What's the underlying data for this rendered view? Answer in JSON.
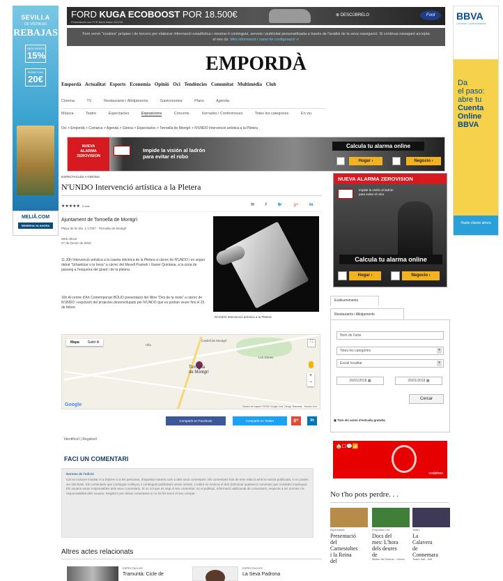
{
  "left_ad": {
    "city": "SEVILLA",
    "tagline": "DE VISITA EN",
    "headline": "REBAJAS",
    "offer1": "15%",
    "offer1_note": "DESCUENTO",
    "offer2": "20€",
    "offer2_note": "BONO CON",
    "brand": "MELIÃ.COM",
    "cta": "RESERVA YA AHORA"
  },
  "right_ad": {
    "brand": "BBVA",
    "brand_sub": "Creando Oportunidades",
    "lines": [
      "Da",
      "el paso:",
      "abre tu"
    ],
    "highlight": [
      "Cuenta",
      "Online",
      "BBVA"
    ],
    "cta": "Hazte cliente ahora"
  },
  "top_banner": {
    "text_prefix": "FORD ",
    "text_model": "KUGA ECOBOOST",
    "text_price": " POR 18.500€",
    "fine_print": "Financiando con FCE Bank hasta 31/1/18",
    "discover": "⊕ DESCÚBRELO",
    "logo": "Ford"
  },
  "cookie": {
    "text": "Fem servir \"cookies\" pròpies i de tercers per elaborar informació estadística i mostrar-li continguts, serveis i publicitat personalitzada a través de l'anàlisi de la seva navegació. Si continua navegant accepta el seu ús.",
    "link": "Més informació i canvi de configuració",
    "ok": "✔"
  },
  "masthead": "EMPORDÀ",
  "main_nav": [
    "Empordà",
    "Actualitat",
    "Esports",
    "Economia",
    "Opinió",
    "Oci",
    "Tendències",
    "Comunitat",
    "Multimèdia",
    "Club"
  ],
  "sub_nav1": [
    "Cinema",
    "TV",
    "Restaurants i Allotjaments",
    "Gastronomia",
    "Plans",
    "Agenda"
  ],
  "sub_nav2": [
    "Música",
    "Teatre",
    "Espectacles",
    "Exposicions",
    "Concerts",
    "Xerrades i Conferències",
    "Totes les categories",
    "En viu"
  ],
  "breadcrumb": "Oci > Empordà > Comarca > Agenda > Girona > Espectacles > Torroella de Montgrí > N'UNDO Intervenció artística a la Pletera",
  "alarm_wide": {
    "badge": [
      "NUEVA",
      "ALARMA",
      "ZEROVISION"
    ],
    "message": [
      "Impide la visión al ladrón",
      "para evitar el robo"
    ],
    "cta": "Calcula tu alarma online",
    "btn1": "Hogar ›",
    "btn2": "Negocio ›"
  },
  "article": {
    "category": "ESPECTACLES A GIRONA",
    "title": "N'UNDO Intervenció artística a la Pletera",
    "rating": "★★★★★",
    "votes": "0 vots",
    "share_mail": "✉",
    "share_fb": "f",
    "share_tw": "🐦",
    "share_gp": "g+",
    "share_li": "in",
    "venue": "Ajuntament de Torroella de Montgrí",
    "address": "Plaça de la Vila, 1 17257 - Torroella de Montgrí",
    "web": "Web oficial",
    "date": "27 de Gener de 2018",
    "p1": "11.30h Intervenció artística a la caseta elèctrica de la Pletera a càrrec de N'UNDO i en seguir debat \"Urbanitzar o la Ireva\" a càrrec del Mesell Pramelr i Xavier Quintana, a la zona de passeig a l'esquerra del girant i de la pletera.",
    "p2": "16h Al centre d'Art Contemporani BÒLID presentació del llibre \"Des de la resta\" a càrrec de N'UNDO i exposició del projectes desenvolupats per N'UNDO que es podran veure fins el 25 de febrer.",
    "caption": "N'UNDO Intervenció artística a la Pletera"
  },
  "map": {
    "tab_map": "Mapa",
    "tab_sat": "Satèl·lit",
    "town": [
      "Torroella",
      "de Montgrí"
    ],
    "castle": "Castell de Montgrí",
    "place1": "Les Dunes",
    "place2": "Ulla",
    "google": "Google",
    "attribution": "Dades de mapes ©2018 Google, Inst. Geogr. Nacional · Termes d'ús"
  },
  "share_buttons": {
    "facebook": "Compartir en Facebook",
    "twitter": "Compartir en Twitter",
    "gplus": "g+",
    "linkedin": "in"
  },
  "login": "Identifica't | Registra't",
  "comment": {
    "heading": "FACI UN COMENTARI",
    "norms_title": "Normes de l'edició",
    "norms_text": "Cal no incloure insultar ni a d'altres ni a les persones, d'aquesta manera com a dels seus comentaris. Els comentaris han de tenir relació amb la notícia publicada; si no poden ser eliminats. Els comentaris que continguin enllaços o continguts publicitaris seran retirats. L'editor es reserva el dret d'eliminar qualsevol comentari que consideri inadequat. Els usuaris seran responsables dels seus comentaris. Si no vol que es vegi el seu comentari, no el publiqui. Informació addicional de comentaris, respecte a les normes i la responsabilitat dels usuaris. Registri's per deixar comentaris si no ha fet servir el seu compte."
  },
  "related": {
    "heading": "Altres actes relacionats",
    "items": [
      {
        "category": "ESPECTACLES",
        "title": "Tramuntà: Cicle de"
      },
      {
        "category": "ESPECTACLES",
        "title": "La Seva Padrona"
      }
    ]
  },
  "alarm_side": {
    "header": "NUEVA ALARMA ZEROVISION",
    "message": [
      "Impide la visión al ladrón",
      "para evitar el robo"
    ],
    "cta": "Calcula tu alarma online",
    "btn1": "Hogar ›",
    "btn2": "Negocio ›"
  },
  "agenda": {
    "tab1": "Esdeveniments",
    "tab2": "Restaurants i Allotjaments",
    "field_name": "Nom de l'acte",
    "field_category": "Totes les categories",
    "field_location": "Escull localitat",
    "date_from": "26/01/2018",
    "date_to": "26/01/2018",
    "search": "Cercar",
    "checkbox": "Tots els actes d'entrada gratuïta"
  },
  "vodafone": {
    "icons": "🏠☐💬📶",
    "brand": "vodafone"
  },
  "miss": {
    "heading": "No t'ho pots perdre. . .",
    "items": [
      {
        "category": "Espectacles",
        "title": [
          "Presentació",
          "del",
          "Carnestoltes",
          "i la Reina",
          "del"
        ],
        "sub": ""
      },
      {
        "category": "Propostes Cinc",
        "title": [
          "Docs del",
          "mes: L'hora",
          "dels deures",
          "de"
        ],
        "sub": "Museu del Cinema - Girona"
      },
      {
        "category": "Teatre",
        "title": [
          "La",
          "Calavera",
          "de",
          "Connemara"
        ],
        "sub": "Teatre Salt - Salt"
      }
    ],
    "colors": [
      "#b78b4a",
      "#3f7f3a",
      "#3e3a55"
    ]
  }
}
